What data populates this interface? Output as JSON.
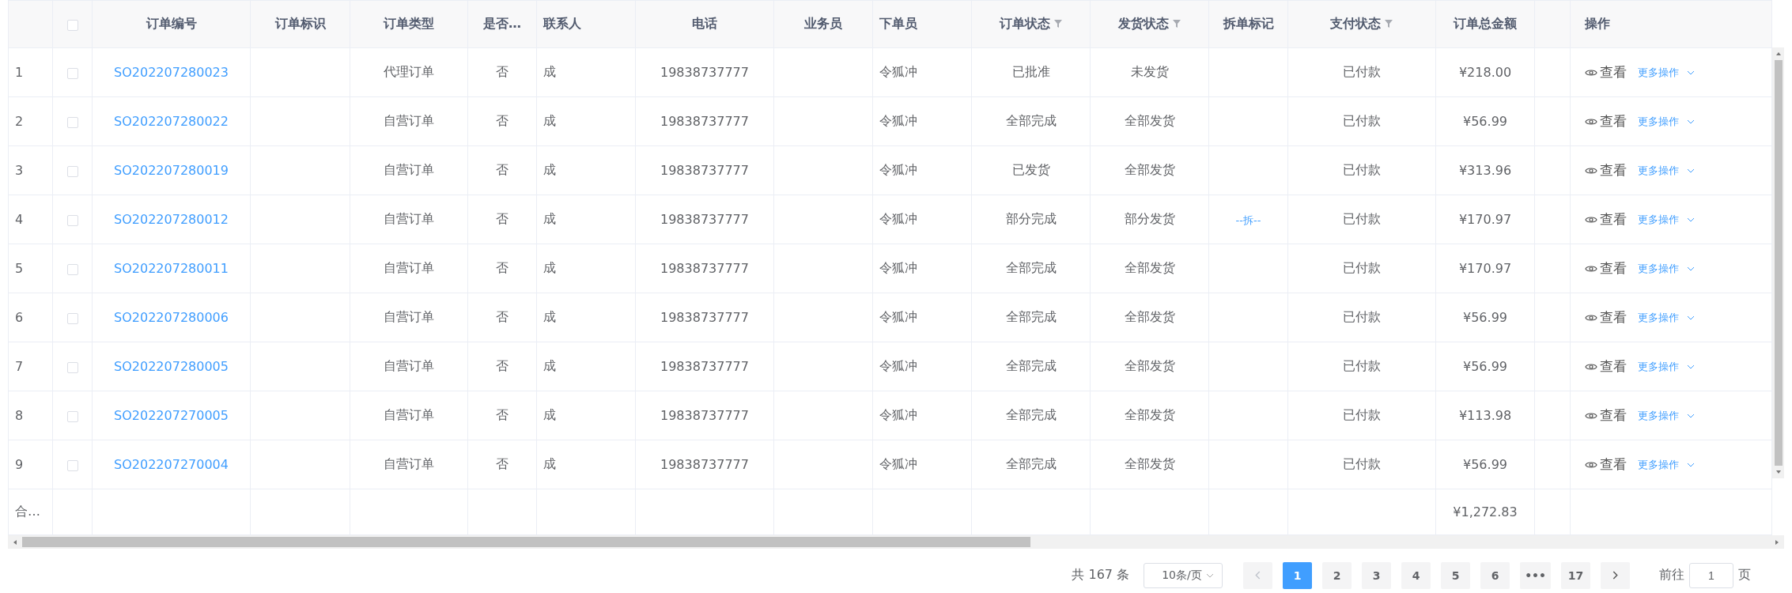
{
  "table": {
    "columns": [
      {
        "kind": "index",
        "filterable": false
      },
      {
        "kind": "checkbox",
        "filterable": false,
        "checked": false
      },
      {
        "label": "订单编号",
        "kind": "text",
        "filterable": false
      },
      {
        "label": "订单标识",
        "kind": "text",
        "filterable": false
      },
      {
        "label": "订单类型",
        "kind": "text",
        "filterable": false
      },
      {
        "label": "是否…",
        "kind": "text",
        "filterable": false
      },
      {
        "label": "联系人",
        "kind": "text",
        "filterable": false
      },
      {
        "label": "电话",
        "kind": "text",
        "filterable": false
      },
      {
        "label": "业务员",
        "kind": "text",
        "filterable": false
      },
      {
        "label": "下单员",
        "kind": "text",
        "filterable": false
      },
      {
        "label": "订单状态",
        "kind": "text",
        "filterable": true
      },
      {
        "label": "发货状态",
        "kind": "text",
        "filterable": true
      },
      {
        "label": "拆单标记",
        "kind": "text",
        "filterable": false
      },
      {
        "label": "支付状态",
        "kind": "text",
        "filterable": true
      },
      {
        "label": "订单总金额",
        "kind": "text",
        "filterable": false
      },
      {
        "kind": "text",
        "filterable": false
      },
      {
        "label": "操作",
        "kind": "actions",
        "filterable": false
      }
    ],
    "rows": [
      {
        "index": "1",
        "checked": false,
        "order_no": "SO202207280023",
        "order_type": "代理订单",
        "flag": "否",
        "contact": "成",
        "phone": "19838737777",
        "orderer": "令狐冲",
        "order_status": "已批准",
        "ship_status": "未发货",
        "pay_status": "已付款",
        "amount": "¥218.00",
        "view": "查看",
        "more": "更多操作"
      },
      {
        "index": "2",
        "checked": false,
        "order_no": "SO202207280022",
        "order_type": "自营订单",
        "flag": "否",
        "contact": "成",
        "phone": "19838737777",
        "orderer": "令狐冲",
        "order_status": "全部完成",
        "ship_status": "全部发货",
        "pay_status": "已付款",
        "amount": "¥56.99",
        "view": "查看",
        "more": "更多操作"
      },
      {
        "index": "3",
        "checked": false,
        "order_no": "SO202207280019",
        "order_type": "自营订单",
        "flag": "否",
        "contact": "成",
        "phone": "19838737777",
        "orderer": "令狐冲",
        "order_status": "已发货",
        "ship_status": "全部发货",
        "pay_status": "已付款",
        "amount": "¥313.96",
        "view": "查看",
        "more": "更多操作"
      },
      {
        "index": "4",
        "checked": false,
        "order_no": "SO202207280012",
        "order_type": "自营订单",
        "flag": "否",
        "contact": "成",
        "phone": "19838737777",
        "orderer": "令狐冲",
        "order_status": "部分完成",
        "ship_status": "部分发货",
        "split": "--拆--",
        "pay_status": "已付款",
        "amount": "¥170.97",
        "view": "查看",
        "more": "更多操作"
      },
      {
        "index": "5",
        "checked": false,
        "order_no": "SO202207280011",
        "order_type": "自营订单",
        "flag": "否",
        "contact": "成",
        "phone": "19838737777",
        "orderer": "令狐冲",
        "order_status": "全部完成",
        "ship_status": "全部发货",
        "pay_status": "已付款",
        "amount": "¥170.97",
        "view": "查看",
        "more": "更多操作"
      },
      {
        "index": "6",
        "checked": false,
        "order_no": "SO202207280006",
        "order_type": "自营订单",
        "flag": "否",
        "contact": "成",
        "phone": "19838737777",
        "orderer": "令狐冲",
        "order_status": "全部完成",
        "ship_status": "全部发货",
        "pay_status": "已付款",
        "amount": "¥56.99",
        "view": "查看",
        "more": "更多操作"
      },
      {
        "index": "7",
        "checked": false,
        "order_no": "SO202207280005",
        "order_type": "自营订单",
        "flag": "否",
        "contact": "成",
        "phone": "19838737777",
        "orderer": "令狐冲",
        "order_status": "全部完成",
        "ship_status": "全部发货",
        "pay_status": "已付款",
        "amount": "¥56.99",
        "view": "查看",
        "more": "更多操作"
      },
      {
        "index": "8",
        "checked": false,
        "order_no": "SO202207270005",
        "order_type": "自营订单",
        "flag": "否",
        "contact": "成",
        "phone": "19838737777",
        "orderer": "令狐冲",
        "order_status": "全部完成",
        "ship_status": "全部发货",
        "pay_status": "已付款",
        "amount": "¥113.98",
        "view": "查看",
        "more": "更多操作"
      },
      {
        "index": "9",
        "checked": false,
        "order_no": "SO202207270004",
        "order_type": "自营订单",
        "flag": "否",
        "contact": "成",
        "phone": "19838737777",
        "orderer": "令狐冲",
        "order_status": "全部完成",
        "ship_status": "全部发货",
        "pay_status": "已付款",
        "amount": "¥56.99",
        "view": "查看",
        "more": "更多操作"
      }
    ],
    "summary": {
      "label": "合…",
      "amount": "¥1,272.83"
    }
  },
  "pagination": {
    "total": "共 167 条",
    "page_size": "10条/页",
    "prev_disabled": true,
    "pages": [
      {
        "label": "1",
        "selected": true
      },
      {
        "label": "2",
        "selected": false
      },
      {
        "label": "3",
        "selected": false
      },
      {
        "label": "4",
        "selected": false
      },
      {
        "label": "5",
        "selected": false
      },
      {
        "label": "6",
        "selected": false
      },
      {
        "label": "•••",
        "selected": false
      },
      {
        "label": "17",
        "selected": false
      }
    ],
    "goto_label": "前往",
    "goto_value": "1",
    "goto_unit": "页"
  }
}
